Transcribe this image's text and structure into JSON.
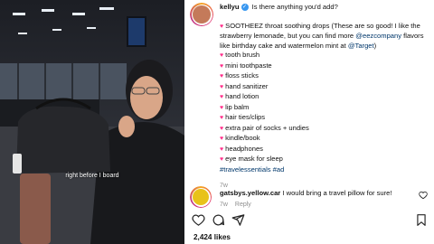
{
  "media": {
    "overlay_caption": "right before I board"
  },
  "post": {
    "username": "kellyu",
    "question": "Is there anything you'd add?",
    "intro_prefix": "SOOTHEEZ throat soothing drops (These are so good! I like the strawberry lemonade, but you can find more ",
    "mention_1": "@eezcompany",
    "intro_mid": " flavors like birthday cake and watermelon mint at ",
    "mention_2": "@Target",
    "intro_suffix": ")",
    "items": [
      "tooth brush",
      "mini toothpaste",
      "floss sticks",
      "hand sanitizer",
      "hand lotion",
      "lip balm",
      "hair ties/clips",
      "extra pair of socks + undies",
      "kindle/book",
      "headphones",
      "eye mask for sleep"
    ],
    "hashtags": "#travelessentials #ad",
    "time_ago": "7w"
  },
  "comment": {
    "username": "gatsbys.yellow.car",
    "text": "I would bring a travel pillow for sure!",
    "time_ago": "7w",
    "reply_label": "Reply"
  },
  "likes_text": "2,424 likes",
  "icons": {
    "heart": "heart-icon",
    "comment": "comment-icon",
    "share": "share-icon",
    "save": "bookmark-icon",
    "verified": "verified-badge-icon"
  },
  "colors": {
    "emoji_heart": "#ff2e8a",
    "link": "#00376b",
    "verified": "#3897f0"
  }
}
